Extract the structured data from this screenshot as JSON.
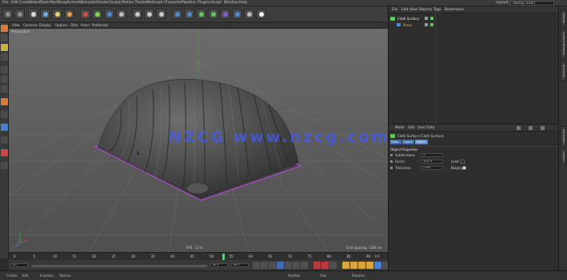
{
  "menubar": {
    "items": [
      "File",
      "Edit",
      "Create",
      "Select",
      "Tools",
      "Mesh",
      "Snap",
      "Animate",
      "Simulate",
      "Render",
      "Sculpt",
      "Motion Tracker",
      "MoGraph",
      "Character",
      "Pipeline",
      "Plugins",
      "Script",
      "Window",
      "Help"
    ],
    "layout_label": "Layout:",
    "layout_value": "Startup (User)"
  },
  "viewport": {
    "menu": [
      "View",
      "Cameras",
      "Display",
      "Options",
      "Filter",
      "Panel",
      "ProRender"
    ],
    "camera_label": "Perspective",
    "grid_spacing": "Grid Spacing : 100 cm",
    "fps": "FPS : 17.6",
    "watermark": "NZCG  www.nzcg.com"
  },
  "timeline": {
    "ticks": [
      "0",
      "5",
      "10",
      "15",
      "20",
      "25",
      "30",
      "35",
      "40",
      "45",
      "50",
      "55",
      "60",
      "65",
      "70",
      "75",
      "80",
      "85",
      "90"
    ],
    "end_label": "0 F"
  },
  "transport": {
    "start_frame": "0 F",
    "current_frame": "0 F",
    "end_frame": "90 F",
    "end_frame2": "90 F"
  },
  "objects_panel": {
    "menu": [
      "File",
      "Edit",
      "View",
      "Objects",
      "Tags",
      "Bookmarks"
    ],
    "items": [
      {
        "name": "Cloth Surface"
      },
      {
        "name": "Plane"
      }
    ]
  },
  "attributes_panel": {
    "menu": [
      "Mode",
      "Edit",
      "User Data"
    ],
    "object_label": "Cloth Surface [Cloth Surface]",
    "tabs": [
      "Basic",
      "Coord.",
      "Object"
    ],
    "section": "Object Properties",
    "fields": [
      {
        "label": "Subdivisions",
        "value": "1"
      },
      {
        "label": "Factor",
        "value": "100 %",
        "check_label": "Limit"
      },
      {
        "label": "Thickness",
        "value": "2 cm",
        "check_label": "Bulging"
      }
    ]
  },
  "side_tabs": [
    "Objects",
    "Content Browser",
    "Structure",
    "Attributes",
    "Layers"
  ],
  "statusbar": {
    "items": [
      "Create",
      "Edit",
      "Function",
      "Texture"
    ],
    "right_items": [
      "Position",
      "Size",
      "Rotation"
    ]
  },
  "colors": {
    "accent_blue": "#3d6fb8",
    "selection_purple": "#b44ad8",
    "watermark": "#4a5ae6",
    "viewport_bg": "#5a5a5a"
  }
}
